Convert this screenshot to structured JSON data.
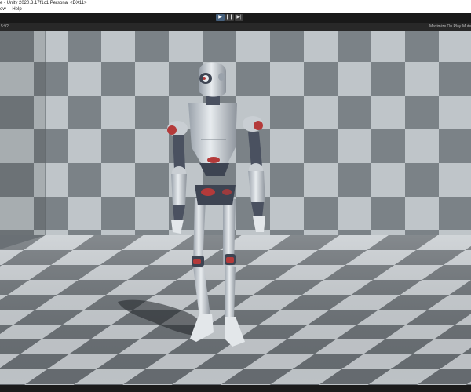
{
  "window": {
    "title": "e - Unity 2020.3.17f1c1 Personal <DX11>"
  },
  "menu": {
    "items": [
      "ow",
      "Help"
    ]
  },
  "toolbar": {
    "play_icon": "play-icon",
    "pause_icon": "pause-icon",
    "step_icon": "step-icon",
    "play_glyph": "▶",
    "pause_glyph": "❚❚",
    "step_glyph": "▶|"
  },
  "game_view": {
    "resolution": "5:9?",
    "maximize_on_play": "Maximize On Play",
    "mute_label": "Mute"
  },
  "colors": {
    "wall_light": "#bfc5c9",
    "wall_dark": "#7b8287",
    "floor_light": "#c7ccd0",
    "floor_dark": "#6a7075",
    "robot_body": "#d4d9de",
    "robot_joint": "#3d4452",
    "robot_accent": "#b43a3a",
    "play_active": "#46607c"
  }
}
